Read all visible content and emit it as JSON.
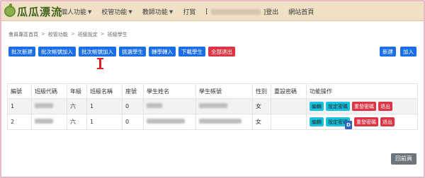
{
  "brand": {
    "logo_text": "瓜瓜漂流"
  },
  "nav": {
    "items": [
      {
        "label": "個人功能",
        "has_caret": true
      },
      {
        "label": "校管功能",
        "has_caret": true
      },
      {
        "label": "教師功能",
        "has_caret": true
      },
      {
        "label": "打賞",
        "has_caret": false
      }
    ],
    "user_open": "[",
    "logout": "]登出",
    "home": "網站首頁"
  },
  "breadcrumb": [
    "會員專區首頁",
    "校管功能",
    "班級設定",
    "班級學生"
  ],
  "toolbar": {
    "buttons": [
      {
        "label": "批次新建",
        "style": "primary"
      },
      {
        "label": "批次帳號加入",
        "style": "primary"
      },
      {
        "label": "批次帳號加入",
        "style": "primary"
      },
      {
        "label": "挑選學生",
        "style": "primary"
      },
      {
        "label": "轉學轉入",
        "style": "primary"
      },
      {
        "label": "下載學生",
        "style": "primary"
      },
      {
        "label": "全部退出",
        "style": "danger"
      }
    ],
    "right": [
      {
        "label": "新建",
        "style": "primary"
      },
      {
        "label": "加入",
        "style": "primary"
      }
    ]
  },
  "table": {
    "headers": [
      "編號",
      "班級代碼",
      "年級",
      "班級名稱",
      "座號",
      "學生姓名",
      "學生帳號",
      "性別",
      "重設密碼",
      "功能操作"
    ],
    "rows": [
      {
        "no": "1",
        "grade": "六",
        "class_name": "1",
        "seat": "0",
        "gender": "女"
      },
      {
        "no": "2",
        "grade": "六",
        "class_name": "1",
        "seat": "0",
        "gender": "女"
      }
    ],
    "actions": {
      "edit": "編輯",
      "set_password": "設定密碼",
      "reset_password": "重發密碼",
      "withdraw": "退出"
    }
  },
  "footer": {
    "back_label": "回前頁"
  },
  "colors": {
    "primary": "#1a6ee6",
    "danger": "#dc3545",
    "info": "#17c1e0",
    "secondary": "#6c757d",
    "topbar": "#efe0c6"
  }
}
